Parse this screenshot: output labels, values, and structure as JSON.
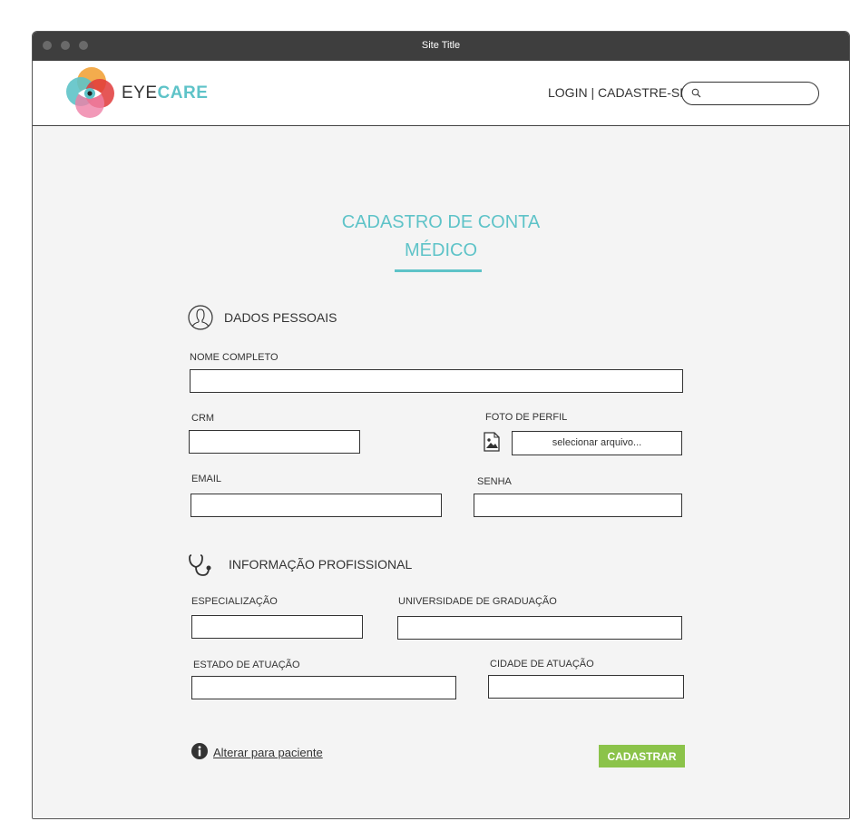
{
  "window": {
    "title": "Site Title"
  },
  "header": {
    "brand_eye": "EYE",
    "brand_care": "CARE",
    "login_label": "LOGIN",
    "separator": " | ",
    "register_label": "CADASTRE-SE",
    "search_placeholder": "",
    "search_icon": "search-icon"
  },
  "form": {
    "title_line1": "CADASTRO DE CONTA",
    "title_line2": "MÉDICO",
    "personal_section": "DADOS PESSOAIS",
    "full_name_label": "NOME COMPLETO",
    "crm_label": "CRM",
    "photo_label": "FOTO  DE PERFIL",
    "photo_button": "selecionar arquivo...",
    "email_label": "EMAIL",
    "password_label": "SENHA",
    "professional_section": "INFORMAÇÃO PROFISSIONAL",
    "specialization_label": "ESPECIALIZAÇÃO",
    "university_label": "UNIVERSIDADE DE GRADUAÇÃO",
    "state_label": "ESTADO DE ATUAÇÃO",
    "city_label": "CIDADE DE ATUAÇÃO",
    "switch_link": "Alterar para paciente",
    "submit_label": "CADASTRAR"
  },
  "colors": {
    "accent": "#5ec3c8",
    "submit": "#8bc34a",
    "titlebar": "#3e3e3e",
    "background": "#f4f4f4"
  }
}
